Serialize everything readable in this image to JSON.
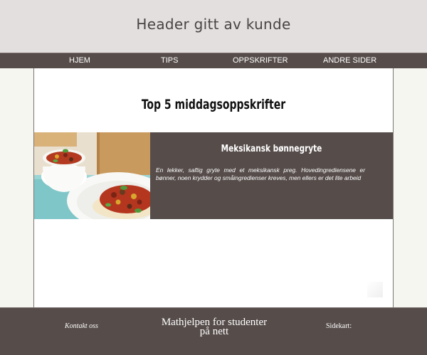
{
  "header": {
    "title": "Header gitt av kunde"
  },
  "nav": {
    "items": [
      {
        "label": "HJEM"
      },
      {
        "label": "TIPS"
      },
      {
        "label": "OPPSKRIFTER"
      },
      {
        "label": "ANDRE SIDER"
      }
    ]
  },
  "main": {
    "title": "Top 5 middagsoppskrifter",
    "recipe": {
      "title": "Meksikansk bønnegryte",
      "description": "En lekker, saftig gryte med et meksikansk preg. Hovedingrediensene er bønner, noen krydder og småingredienser kreves, men ellers er det lite arbeid"
    }
  },
  "footer": {
    "contact": "Kontakt oss",
    "center_line1": "Mathjelpen for studenter",
    "center_line2": "på nett",
    "sitemap": "Sidekart:"
  },
  "colors": {
    "header_bg": "#e3dfdf",
    "bar_bg": "#564d4b",
    "page_bg": "#f4f6ef"
  }
}
